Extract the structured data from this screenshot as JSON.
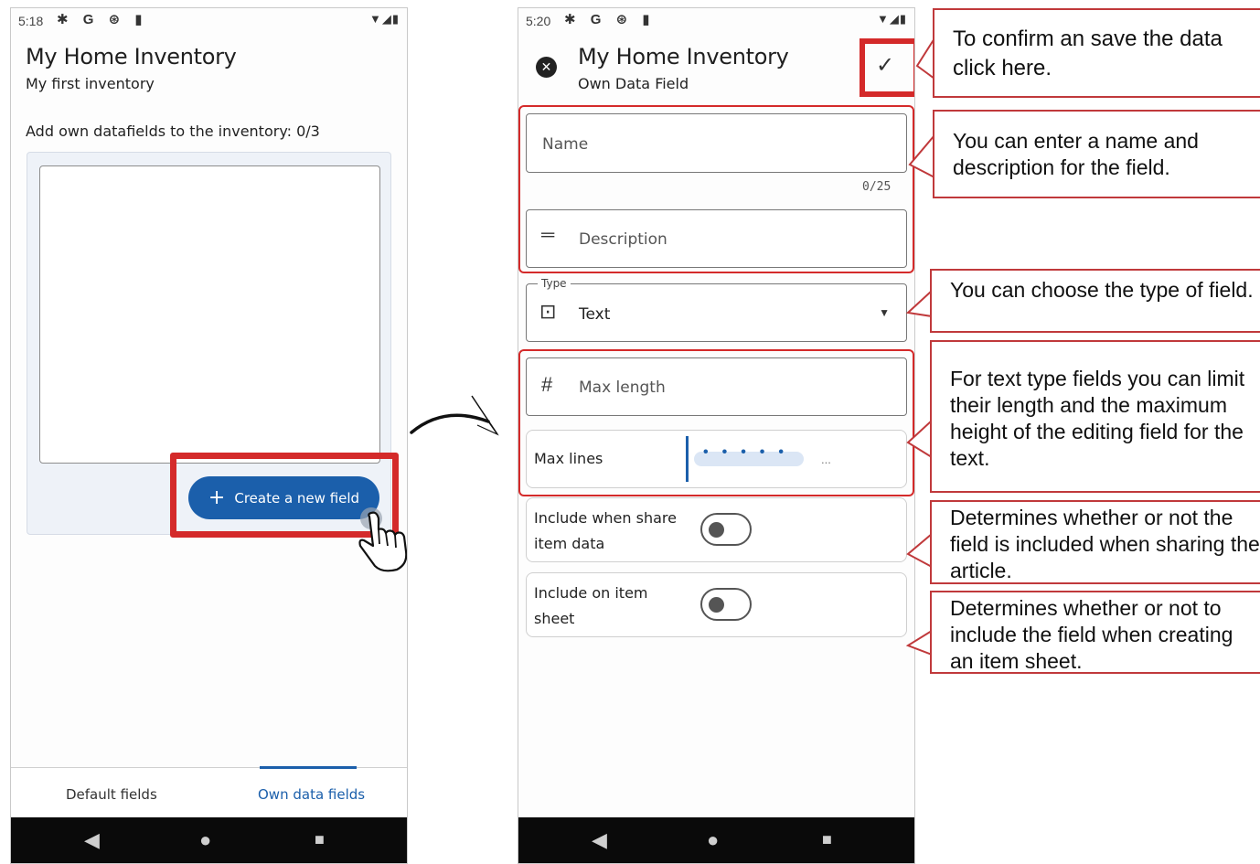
{
  "phone1": {
    "status_time": "5:18",
    "status_icons": "✱ G ⊛ ▮",
    "status_right": "▼◢▮",
    "title": "My Home Inventory",
    "subtitle": "My first inventory",
    "heading": "Add own datafields to the inventory: 0/3",
    "create_button": "Create a new field",
    "create_icon": "+",
    "tabs": [
      "Default fields",
      "Own data fields"
    ],
    "active_tab": "Own data fields"
  },
  "phone2": {
    "status_time": "5:20",
    "status_icons": "✱ G ⊛ ▮",
    "status_right": "▼◢▮",
    "title": "My Home Inventory",
    "subtitle": "Own Data Field",
    "close_icon": "✕",
    "confirm_icon": "✓",
    "name_placeholder": "Name",
    "name_counter": "0/25",
    "description_placeholder": "Description",
    "type_label": "Type",
    "type_value": "Text",
    "max_length_placeholder": "Max length",
    "max_lines_label": "Max lines",
    "max_lines_more": "...",
    "share_toggle_label": "Include when share item data",
    "sheet_toggle_label": "Include on item sheet",
    "share_toggle_on": false,
    "sheet_toggle_on": false
  },
  "navbar": {
    "back": "◀",
    "home": "●",
    "recent": "■"
  },
  "annotations": [
    "To confirm an save the data click here.",
    "You can enter a name and description for the field.",
    "You can choose the type of field.",
    "For text type fields you can limit their length and the maximum height of the editing field for the text.",
    "Determines whether or not the field is included when sharing the article.",
    "Determines whether or not to include the field when creating an item sheet."
  ],
  "colors": {
    "primary": "#1b5fab",
    "highlight": "#d42a2a",
    "annotation_border": "#c0393b"
  }
}
